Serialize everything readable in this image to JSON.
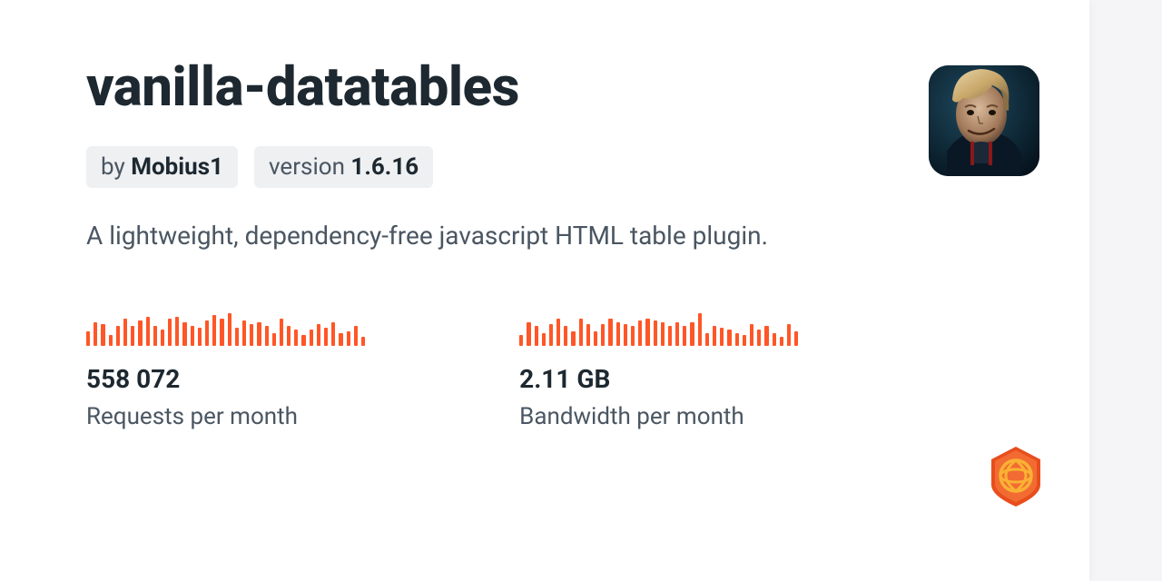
{
  "package": {
    "name": "vanilla-datatables",
    "author_prefix": "by ",
    "author": "Mobius1",
    "version_prefix": "version ",
    "version": "1.6.16",
    "description": "A lightweight, dependency-free javascript HTML table plugin."
  },
  "stats": {
    "requests": {
      "value": "558 072",
      "label": "Requests per month"
    },
    "bandwidth": {
      "value": "2.11 GB",
      "label": "Bandwidth per month"
    }
  },
  "chart_data": [
    {
      "type": "bar",
      "title": "Requests sparkline",
      "values": [
        16,
        26,
        24,
        12,
        22,
        30,
        22,
        28,
        32,
        22,
        18,
        30,
        32,
        26,
        22,
        20,
        28,
        34,
        30,
        36,
        20,
        28,
        24,
        26,
        22,
        14,
        30,
        22,
        18,
        12,
        18,
        24,
        20,
        26,
        14,
        16,
        22,
        10
      ]
    },
    {
      "type": "bar",
      "title": "Bandwidth sparkline",
      "values": [
        12,
        26,
        22,
        14,
        24,
        30,
        22,
        16,
        30,
        24,
        16,
        24,
        30,
        26,
        24,
        22,
        28,
        30,
        28,
        26,
        22,
        26,
        22,
        26,
        36,
        14,
        22,
        20,
        18,
        14,
        12,
        24,
        18,
        22,
        14,
        10,
        24,
        16
      ]
    }
  ],
  "colors": {
    "accent": "#ff5627",
    "text_primary": "#1d2830",
    "text_secondary": "#4a5662",
    "tag_bg": "#eef0f2"
  }
}
